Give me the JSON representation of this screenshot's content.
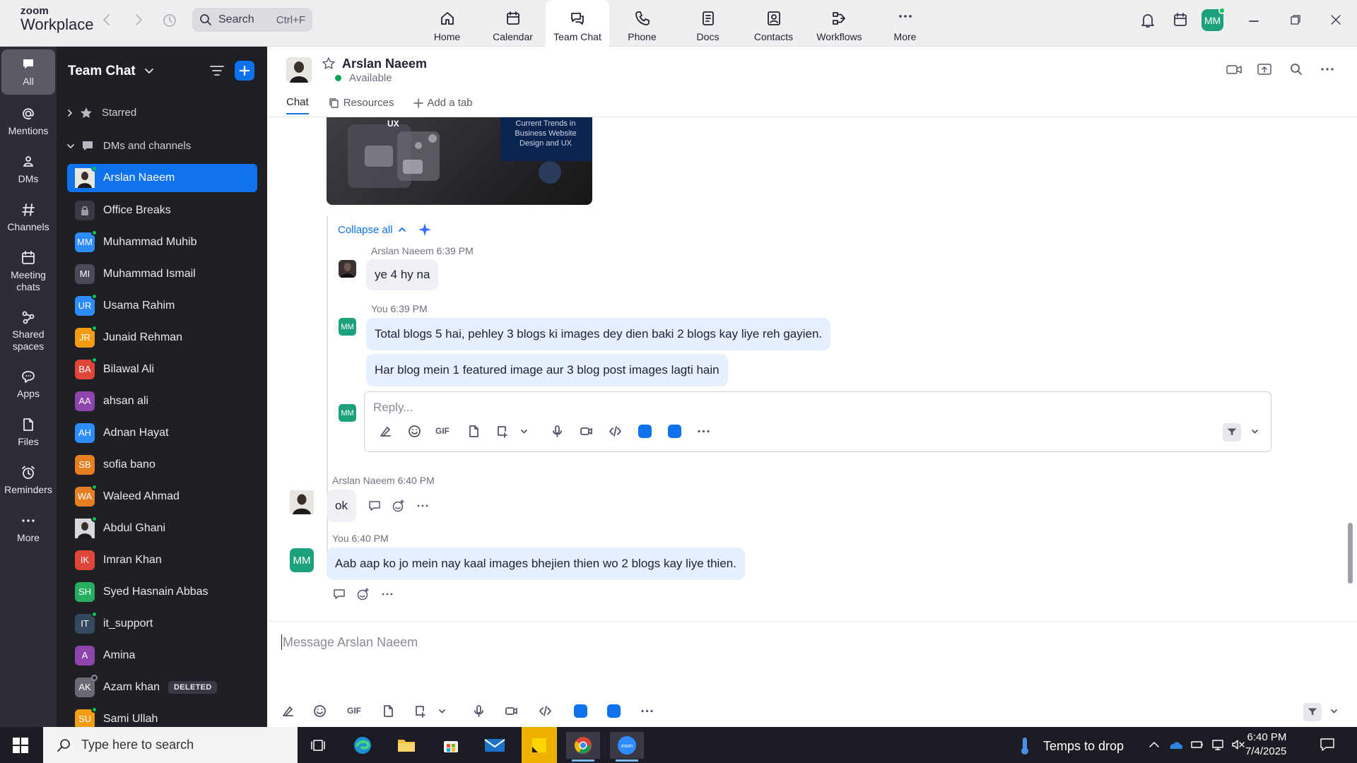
{
  "app": {
    "brand_top": "zoom",
    "brand_bottom": "Workplace"
  },
  "search": {
    "label": "Search",
    "shortcut": "Ctrl+F"
  },
  "nav_tabs": [
    {
      "label": "Home",
      "icon": "home-icon"
    },
    {
      "label": "Calendar",
      "icon": "calendar-icon"
    },
    {
      "label": "Team Chat",
      "icon": "chat-icon",
      "active": true
    },
    {
      "label": "Phone",
      "icon": "phone-icon"
    },
    {
      "label": "Docs",
      "icon": "docs-icon"
    },
    {
      "label": "Contacts",
      "icon": "contacts-icon"
    },
    {
      "label": "Workflows",
      "icon": "workflows-icon"
    },
    {
      "label": "More",
      "icon": "more-icon"
    }
  ],
  "profile": {
    "initials": "MM"
  },
  "rail": [
    {
      "label": "All",
      "active": true
    },
    {
      "label": "Mentions"
    },
    {
      "label": "DMs"
    },
    {
      "label": "Channels"
    },
    {
      "label": "Meeting chats"
    },
    {
      "label": "Shared spaces"
    },
    {
      "label": "Apps"
    },
    {
      "label": "Files"
    },
    {
      "label": "Reminders"
    },
    {
      "label": "More"
    }
  ],
  "sidebar": {
    "title": "Team Chat",
    "sections": {
      "starred": "Starred",
      "dms": "DMs and channels"
    },
    "chats": [
      {
        "name": "Arslan Naeem",
        "initials": "",
        "color": "#3b3131",
        "active": true,
        "status": "online"
      },
      {
        "name": "Office Breaks",
        "initials": "",
        "color": "#3a3a44",
        "status": "lock"
      },
      {
        "name": "Muhammad Muhib",
        "initials": "MM",
        "color": "#2d8cff",
        "status": "online"
      },
      {
        "name": "Muhammad Ismail",
        "initials": "MI",
        "color": "#4a4a5a",
        "status": "none"
      },
      {
        "name": "Usama Rahim",
        "initials": "UR",
        "color": "#2d8cff",
        "status": "online"
      },
      {
        "name": "Junaid Rehman",
        "initials": "JR",
        "color": "#f39c12",
        "status": "online"
      },
      {
        "name": "Bilawal Ali",
        "initials": "BA",
        "color": "#e0453a",
        "status": "online"
      },
      {
        "name": "ahsan ali",
        "initials": "AA",
        "color": "#8e44ad",
        "status": "none"
      },
      {
        "name": "Adnan Hayat",
        "initials": "AH",
        "color": "#2d8cff",
        "status": "none"
      },
      {
        "name": "sofia bano",
        "initials": "SB",
        "color": "#e67e22",
        "status": "none"
      },
      {
        "name": "Waleed Ahmad",
        "initials": "WA",
        "color": "#e67e22",
        "status": "online"
      },
      {
        "name": "Abdul Ghani",
        "initials": "",
        "color": "#9a9aa4",
        "status": "online"
      },
      {
        "name": "Imran Khan",
        "initials": "IK",
        "color": "#e0453a",
        "status": "none"
      },
      {
        "name": "Syed Hasnain Abbas",
        "initials": "SH",
        "color": "#27ae60",
        "status": "none"
      },
      {
        "name": "it_support",
        "initials": "IT",
        "color": "#34495e",
        "status": "online"
      },
      {
        "name": "Amina",
        "initials": "A",
        "color": "#8e44ad",
        "status": "none"
      },
      {
        "name": "Azam khan",
        "initials": "AK",
        "color": "#6a6a74",
        "status": "offline",
        "badge": "DELETED"
      },
      {
        "name": "Sami Ullah",
        "initials": "SU",
        "color": "#f39c12",
        "status": "online"
      }
    ]
  },
  "header": {
    "name": "Arslan Naeem",
    "status": "Available",
    "tabs": [
      "Chat",
      "Resources",
      "Add a tab"
    ]
  },
  "thread": {
    "image_title": "Current Trends in Business Website Design and UX",
    "image_tag": "UX",
    "collapse_label": "Collapse all",
    "replies": [
      {
        "sender": "Arslan Naeem",
        "time": "6:39 PM",
        "texts": [
          "ye 4 hy na"
        ]
      },
      {
        "sender": "You",
        "time": "6:39 PM",
        "initials": "MM",
        "texts": [
          "Total blogs 5 hai, pehley 3 blogs ki images dey dien baki 2 blogs kay liye reh gayien.",
          "Har blog mein 1 featured image aur 3 blog post images lagti hain"
        ]
      }
    ],
    "reply_placeholder": "Reply..."
  },
  "messages": [
    {
      "sender": "Arslan Naeem",
      "time": "6:40 PM",
      "text": "ok"
    },
    {
      "sender": "You",
      "time": "6:40 PM",
      "initials": "MM",
      "text": "Aab aap ko jo mein nay kaal images bhejien thien wo 2 blogs kay liye thien."
    }
  ],
  "composer": {
    "placeholder": "Message Arslan Naeem",
    "gif_label": "GIF"
  },
  "taskbar": {
    "search_placeholder": "Type here to search",
    "weather": "Temps to drop",
    "time": "6:40 PM",
    "date": "7/4/2025"
  },
  "colors": {
    "accent": "#0e72ed",
    "sidebar_bg": "#1f1f26",
    "rail_bg": "#2d2d37",
    "online": "#00c853"
  }
}
